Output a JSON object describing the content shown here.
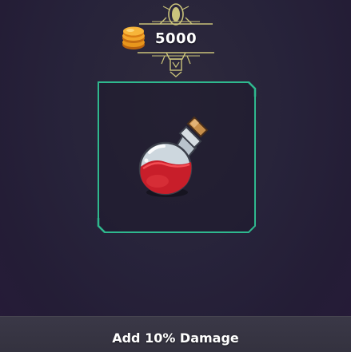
{
  "shop_item": {
    "cost": {
      "amount": "5000",
      "currency_icon": "gold-coins-icon"
    },
    "item_icon": "health-potion-icon",
    "effect": "Add 10% Damage"
  },
  "colors": {
    "slot_border": "#2fb88e",
    "ornament": "#c9c27a",
    "potion_liquid": "#c81e2a",
    "coin": "#e8961c"
  }
}
